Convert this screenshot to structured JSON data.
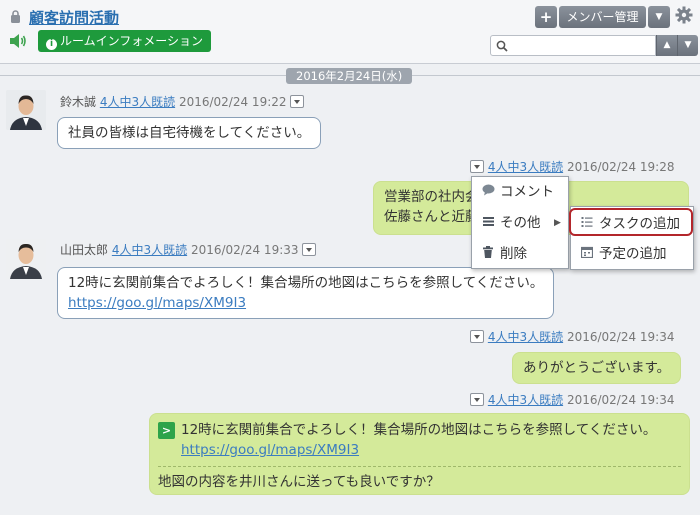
{
  "header": {
    "room_title": "顧客訪問活動",
    "room_info_label": "ルームインフォメーション",
    "add_label": "+",
    "member_label": "メンバー管理",
    "search_placeholder": ""
  },
  "date_separator": "2016年2月24日(水)",
  "messages": [
    {
      "sender": "鈴木誠",
      "read": "4人中3人既読",
      "time": "2016/02/24 19:22",
      "text": "社員の皆様は自宅待機をしてください。"
    },
    {
      "read": "4人中3人既読",
      "time": "2016/02/24 19:28",
      "line1": "営業部の社内会",
      "line2": "佐藤さんと近藤"
    },
    {
      "sender": "山田太郎",
      "read": "4人中3人既読",
      "time": "2016/02/24 19:33",
      "text": "12時に玄関前集合でよろしく！集合場所の地図はこちらを参照してください。",
      "link": "https://goo.gl/maps/XM9I3"
    },
    {
      "read": "4人中3人既読",
      "time": "2016/02/24 19:34",
      "text": "ありがとうございます。"
    },
    {
      "read": "4人中3人既読",
      "time": "2016/02/24 19:34",
      "quote_text": "12時に玄関前集合でよろしく！集合場所の地図はこちらを参照してください。",
      "quote_link": "https://goo.gl/maps/XM9I3",
      "text": "地図の内容を井川さんに送っても良いですか？"
    }
  ],
  "context_menu": {
    "items": [
      {
        "label": "コメント",
        "icon": "comment-icon"
      },
      {
        "label": "その他",
        "icon": "list-icon"
      },
      {
        "label": "削除",
        "icon": "trash-icon"
      }
    ]
  },
  "submenu": {
    "items": [
      {
        "label": "タスクの追加",
        "icon": "task-icon"
      },
      {
        "label": "予定の追加",
        "icon": "calendar-icon"
      }
    ]
  },
  "colors": {
    "accent": "#2a6fb0",
    "room_info_green": "#1e9a3c",
    "my_bubble": "#d4ea9a",
    "highlight_border": "#b3262b"
  }
}
